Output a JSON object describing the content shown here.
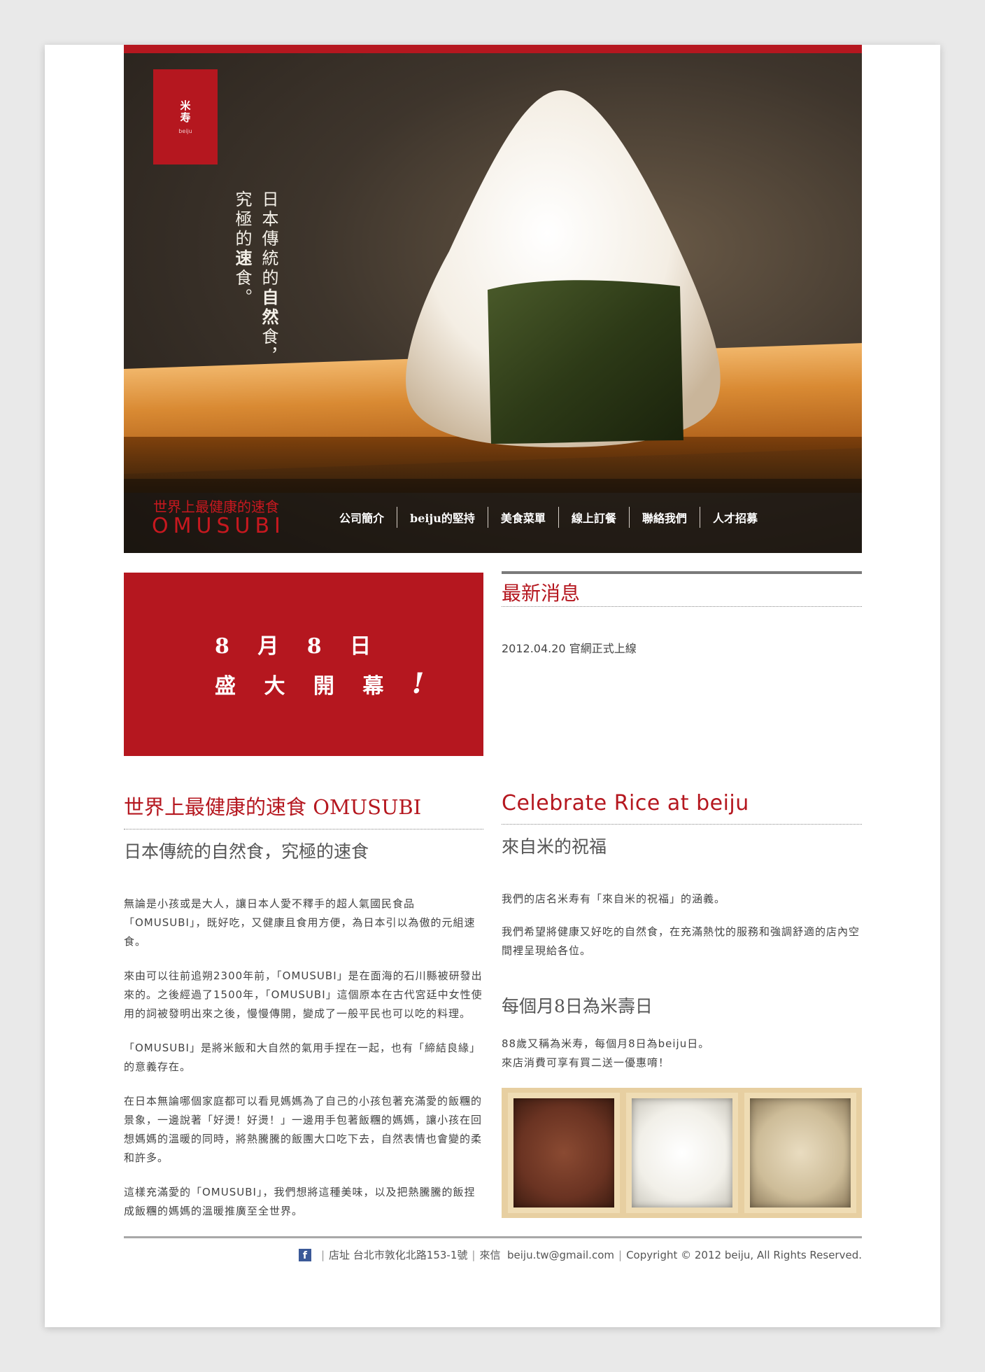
{
  "brand": {
    "logo_kanji": "米寿",
    "logo_latin": "beiju",
    "tagline_line1_a": "日本傳統的",
    "tagline_line1_b": "自然",
    "tagline_line1_c": "食，",
    "tagline_line2_a": "究極的",
    "tagline_line2_b": "速",
    "tagline_line2_c": "食。",
    "slogan_cn": "世界上最健康的速食",
    "slogan_en": "OMUSUBI"
  },
  "nav": [
    {
      "label": "公司簡介"
    },
    {
      "label": "beiju的堅持"
    },
    {
      "label": "美食菜單"
    },
    {
      "label": "線上訂餐"
    },
    {
      "label": "聯絡我們"
    },
    {
      "label": "人才招募"
    }
  ],
  "opening": {
    "line1": "8 月 8 日",
    "line2": "盛 大 開 幕",
    "bang": "!"
  },
  "news": {
    "title": "最新消息",
    "items": [
      "2012.04.20 官網正式上線"
    ]
  },
  "left": {
    "title": "世界上最健康的速食 OMUSUBI",
    "subtitle": "日本傳統的自然食，究極的速食",
    "paragraphs": [
      "無論是小孩或是大人，讓日本人愛不釋手的超人氣國民食品「OMUSUBI」，既好吃，又健康且食用方便，為日本引以為傲的元組速食。",
      "來由可以往前追朔2300年前，「OMUSUBI」是在面海的石川縣被研發出來的。之後經過了1500年，「OMUSUBI」這個原本在古代宮廷中女性使用的詞被發明出來之後，慢慢傳開，變成了一般平民也可以吃的料理。",
      "「OMUSUBI」是將米飯和大自然的氣用手捏在一起，也有「締結良緣」的意義存在。",
      "在日本無論哪個家庭都可以看見媽媽為了自己的小孩包著充滿愛的飯糰的景象，一邊說著「好燙！好燙！」一邊用手包著飯糰的媽媽，讓小孩在回想媽媽的溫暖的同時，將熱騰騰的飯團大口吃下去，自然表情也會變的柔和許多。",
      "這樣充滿愛的「OMUSUBI」，我們想將這種美味，以及把熱騰騰的飯捏成飯糰的媽媽的溫暖推廣至全世界。"
    ]
  },
  "right": {
    "title": "Celebrate Rice at beiju",
    "subtitle": "來自米的祝福",
    "para1": "我們的店名米寿有「來自米的祝福」的涵義。",
    "para2": "我們希望將健康又好吃的自然食，在充滿熱忱的服務和強調舒適的店內空間裡呈現給各位。",
    "subtitle2": "每個月8日為米壽日",
    "para3_line1": "88歲又稱為米寿，每個月8日為beiju日。",
    "para3_line2": "來店消費可享有買二送一優惠唷！"
  },
  "footer": {
    "fb_glyph": "f",
    "address_label": "店址",
    "address": "台北市敦化北路153-1號",
    "contact_label": "來信",
    "email": "beiju.tw@gmail.com",
    "copyright": "Copyright © 2012 beiju, All Rights Reserved."
  },
  "colors": {
    "brand_red": "#b5171f",
    "facebook_blue": "#3b5998"
  }
}
